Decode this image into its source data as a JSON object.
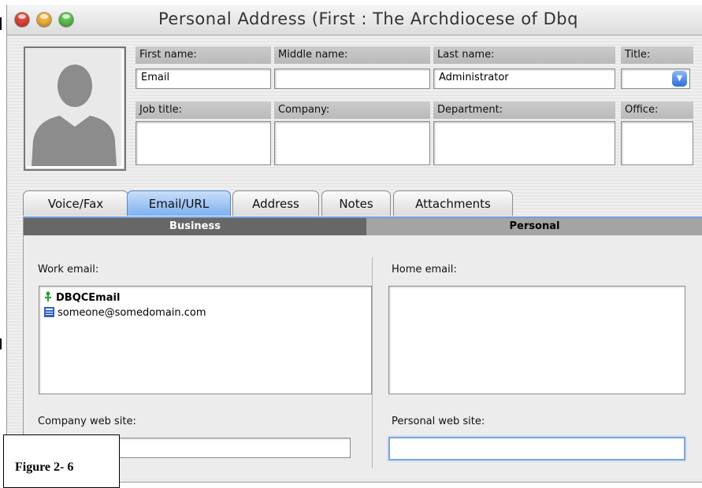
{
  "window": {
    "title": "Personal Address (First : The Archdiocese of Dbq",
    "traffic_lights": {
      "close": "#e0473a",
      "minimize": "#f2b33a",
      "zoom": "#5fc24a"
    }
  },
  "contact": {
    "photo": "person-silhouette-icon",
    "fields": {
      "first_name": {
        "label": "First name:",
        "value": "Email"
      },
      "middle_name": {
        "label": "Middle name:",
        "value": ""
      },
      "last_name": {
        "label": "Last name:",
        "value": "Administrator"
      },
      "title": {
        "label": "Title:",
        "value": ""
      },
      "job_title": {
        "label": "Job title:",
        "value": ""
      },
      "company": {
        "label": "Company:",
        "value": ""
      },
      "department": {
        "label": "Department:",
        "value": ""
      },
      "office": {
        "label": "Office:",
        "value": ""
      }
    }
  },
  "tabs": [
    {
      "label": "Voice/Fax",
      "active": false
    },
    {
      "label": "Email/URL",
      "active": true
    },
    {
      "label": "Address",
      "active": false
    },
    {
      "label": "Notes",
      "active": false
    },
    {
      "label": "Attachments",
      "active": false
    }
  ],
  "segments": {
    "business": "Business",
    "personal": "Personal"
  },
  "business": {
    "work_email_label": "Work email:",
    "entries": [
      {
        "icon": "contact-icon",
        "text": "DBQCEmail",
        "bold": true
      },
      {
        "icon": "email-address-icon",
        "text": "someone@somedomain.com",
        "bold": false
      }
    ],
    "web_site_label": "Company web site:",
    "web_site_value": ""
  },
  "personal": {
    "home_email_label": "Home email:",
    "web_site_label": "Personal web site:",
    "web_site_value": ""
  },
  "figure_caption": "Figure 2- 6",
  "accent_color": "#6fa0de"
}
